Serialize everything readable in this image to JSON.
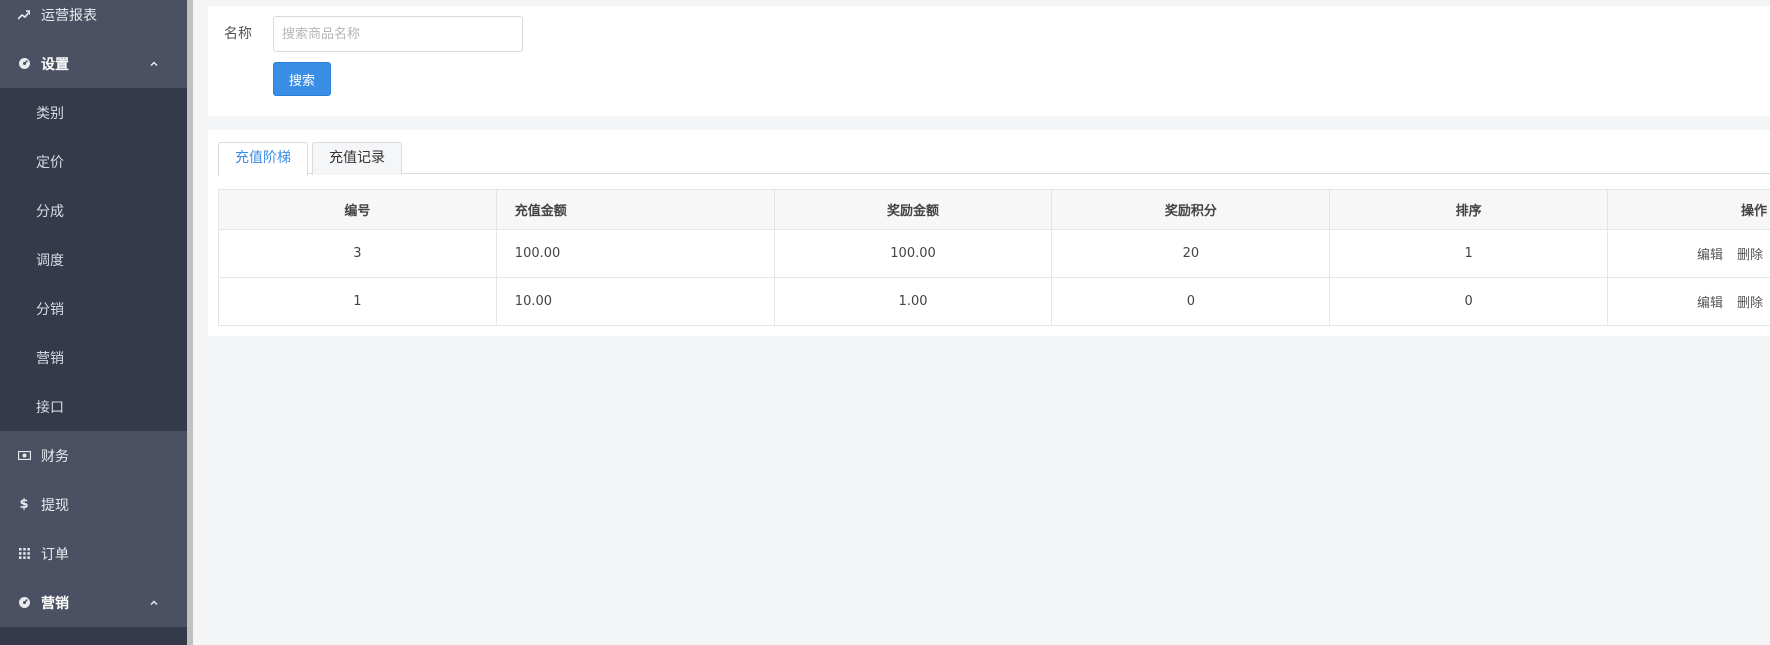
{
  "sidebar": {
    "items": [
      {
        "label": "运营报表",
        "icon": "trend-up-icon",
        "type": "top"
      },
      {
        "label": "设置",
        "icon": "dashboard-icon",
        "type": "group",
        "expanded": true
      },
      {
        "label": "类别",
        "type": "sub"
      },
      {
        "label": "定价",
        "type": "sub"
      },
      {
        "label": "分成",
        "type": "sub"
      },
      {
        "label": "调度",
        "type": "sub"
      },
      {
        "label": "分销",
        "type": "sub"
      },
      {
        "label": "营销",
        "type": "sub"
      },
      {
        "label": "接口",
        "type": "sub"
      },
      {
        "label": "财务",
        "icon": "money-icon",
        "type": "top"
      },
      {
        "label": "提现",
        "icon": "dollar-icon",
        "type": "top"
      },
      {
        "label": "订单",
        "icon": "grid-icon",
        "type": "top"
      },
      {
        "label": "营销",
        "icon": "dashboard-icon",
        "type": "group",
        "expanded": true
      }
    ]
  },
  "search": {
    "label": "名称",
    "placeholder": "搜索商品名称",
    "value": "",
    "button_label": "搜索"
  },
  "tabs": [
    {
      "label": "充值阶梯",
      "active": true
    },
    {
      "label": "充值记录",
      "active": false
    }
  ],
  "table": {
    "columns": [
      "编号",
      "充值金额",
      "奖励金额",
      "奖励积分",
      "排序",
      "操作"
    ],
    "rows": [
      {
        "id": "3",
        "amount": "100.00",
        "reward": "100.00",
        "points": "20",
        "sort": "1",
        "edit": "编辑",
        "delete": "删除"
      },
      {
        "id": "1",
        "amount": "10.00",
        "reward": "1.00",
        "points": "0",
        "sort": "0",
        "edit": "编辑",
        "delete": "删除"
      }
    ]
  },
  "colors": {
    "sidebar_bg": "#4b5163",
    "sidebar_sub_bg": "#343a4a",
    "accent": "#3a8ee6"
  }
}
